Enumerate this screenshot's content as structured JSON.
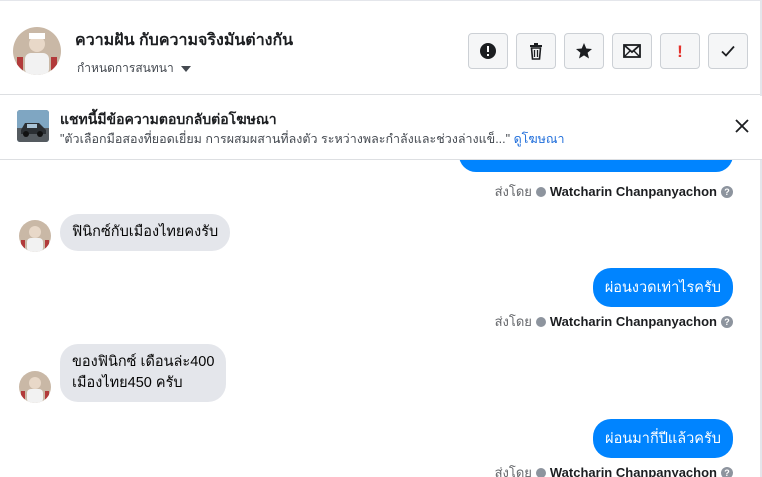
{
  "header": {
    "title": "ความฝัน กับความจริงมันต่างกัน",
    "subtitle": "กำหนดการสนทนา",
    "actions": [
      {
        "name": "info-circle-icon",
        "label": "!"
      },
      {
        "name": "trash-icon",
        "label": ""
      },
      {
        "name": "star-icon",
        "label": ""
      },
      {
        "name": "mail-icon",
        "label": ""
      },
      {
        "name": "spam-icon",
        "label": "!"
      },
      {
        "name": "check-icon",
        "label": ""
      }
    ]
  },
  "banner": {
    "title": "แชทนี้มีข้อความตอบกลับต่อโฆษณา",
    "text": "\"ตัวเลือกมือสองที่ยอดเยี่ยม การผสมผสานที่ลงตัว ระหว่างพละกำลังและช่วงล่างแข็...\"",
    "link": "ดูโฆษณา"
  },
  "messages": {
    "out_partial": "",
    "sent_by_label": "ส่งโดย",
    "sender_name": "Watcharin Chanpanyachon",
    "in_1": "ฟินิกซ์กับเมืองไทยคงรับ",
    "out_1": "ผ่อนงวดเท่าไรครับ",
    "in_2_line1": "ของฟินิกซ์ เดือนล่ะ400",
    "in_2_line2": "เมืองไทย450 ครับ",
    "out_2": "ผ่อนมากี่ปีแล้วครับ"
  },
  "colors": {
    "accent": "#0084ff",
    "link": "#216fdb",
    "incoming_bubble": "#e4e6eb",
    "spam": "#e4322c"
  }
}
